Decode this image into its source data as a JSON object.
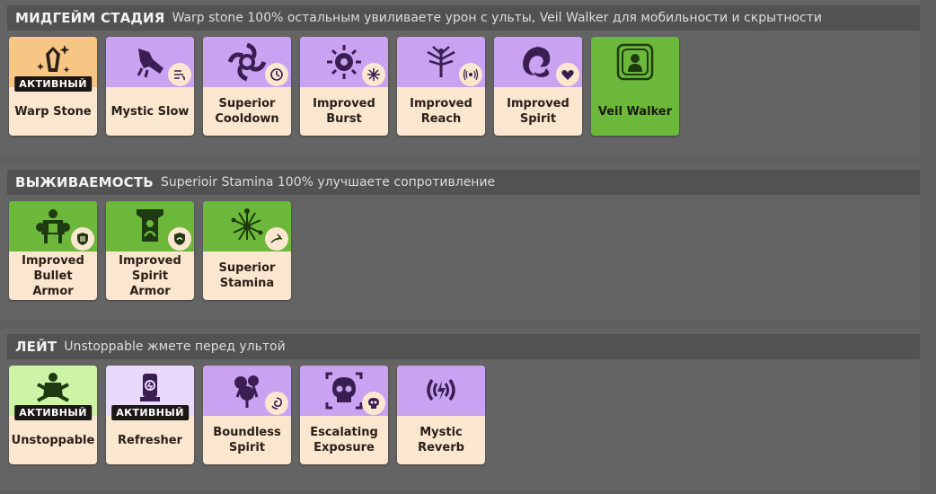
{
  "sections": [
    {
      "title": "МИДГЕЙМ СТАДИЯ",
      "desc": "Warp stone 100% остальным увиливаете урон с ульты, Veil Walker для мобильности и скрытности",
      "items": [
        {
          "name": "Warp Stone",
          "color": "orange",
          "icon": "warp-stone-icon",
          "active": true
        },
        {
          "name": "Mystic Slow",
          "color": "purple",
          "icon": "mystic-slow-icon",
          "sub_icon": "slow-icon"
        },
        {
          "name": "Superior Cooldown",
          "color": "purple",
          "icon": "superior-cooldown-icon",
          "sub_icon": "cooldown-icon"
        },
        {
          "name": "Improved Burst",
          "color": "purple",
          "icon": "improved-burst-icon",
          "sub_icon": "burst-icon"
        },
        {
          "name": "Improved Reach",
          "color": "purple",
          "icon": "improved-reach-icon",
          "sub_icon": "range-icon"
        },
        {
          "name": "Improved Spirit",
          "color": "purple",
          "icon": "improved-spirit-icon",
          "sub_icon": "spirit-heart-icon"
        },
        {
          "name": "Veil Walker",
          "color": "green",
          "icon": "veil-walker-icon"
        }
      ]
    },
    {
      "title": "ВЫЖИВАЕМОСТЬ",
      "desc": "Superioir Stamina 100% улучшаете сопротивление",
      "items": [
        {
          "name": "Improved Bullet Armor",
          "color": "green",
          "icon": "bullet-armor-icon",
          "sub_icon": "bullet-shield-icon"
        },
        {
          "name": "Improved Spirit Armor",
          "color": "green",
          "icon": "spirit-armor-icon",
          "sub_icon": "spirit-shield-icon"
        },
        {
          "name": "Superior Stamina",
          "color": "green",
          "icon": "superior-stamina-icon",
          "sub_icon": "stamina-icon"
        }
      ]
    },
    {
      "title": "ЛЕЙТ",
      "desc": "Unstoppable жмете перед ультой",
      "items": [
        {
          "name": "Unstoppable",
          "color": "lgreen",
          "icon": "unstoppable-icon",
          "active": true
        },
        {
          "name": "Refresher",
          "color": "lpurple",
          "icon": "refresher-icon",
          "active": true
        },
        {
          "name": "Boundless Spirit",
          "color": "purple",
          "icon": "boundless-spirit-icon",
          "sub_icon": "spirit-swirl-icon"
        },
        {
          "name": "Escalating Exposure",
          "color": "purple",
          "icon": "escalating-exposure-icon",
          "sub_icon": "skull-icon"
        },
        {
          "name": "Mystic Reverb",
          "color": "purple",
          "icon": "mystic-reverb-icon"
        }
      ]
    }
  ],
  "active_label": "АКТИВНЫЙ"
}
